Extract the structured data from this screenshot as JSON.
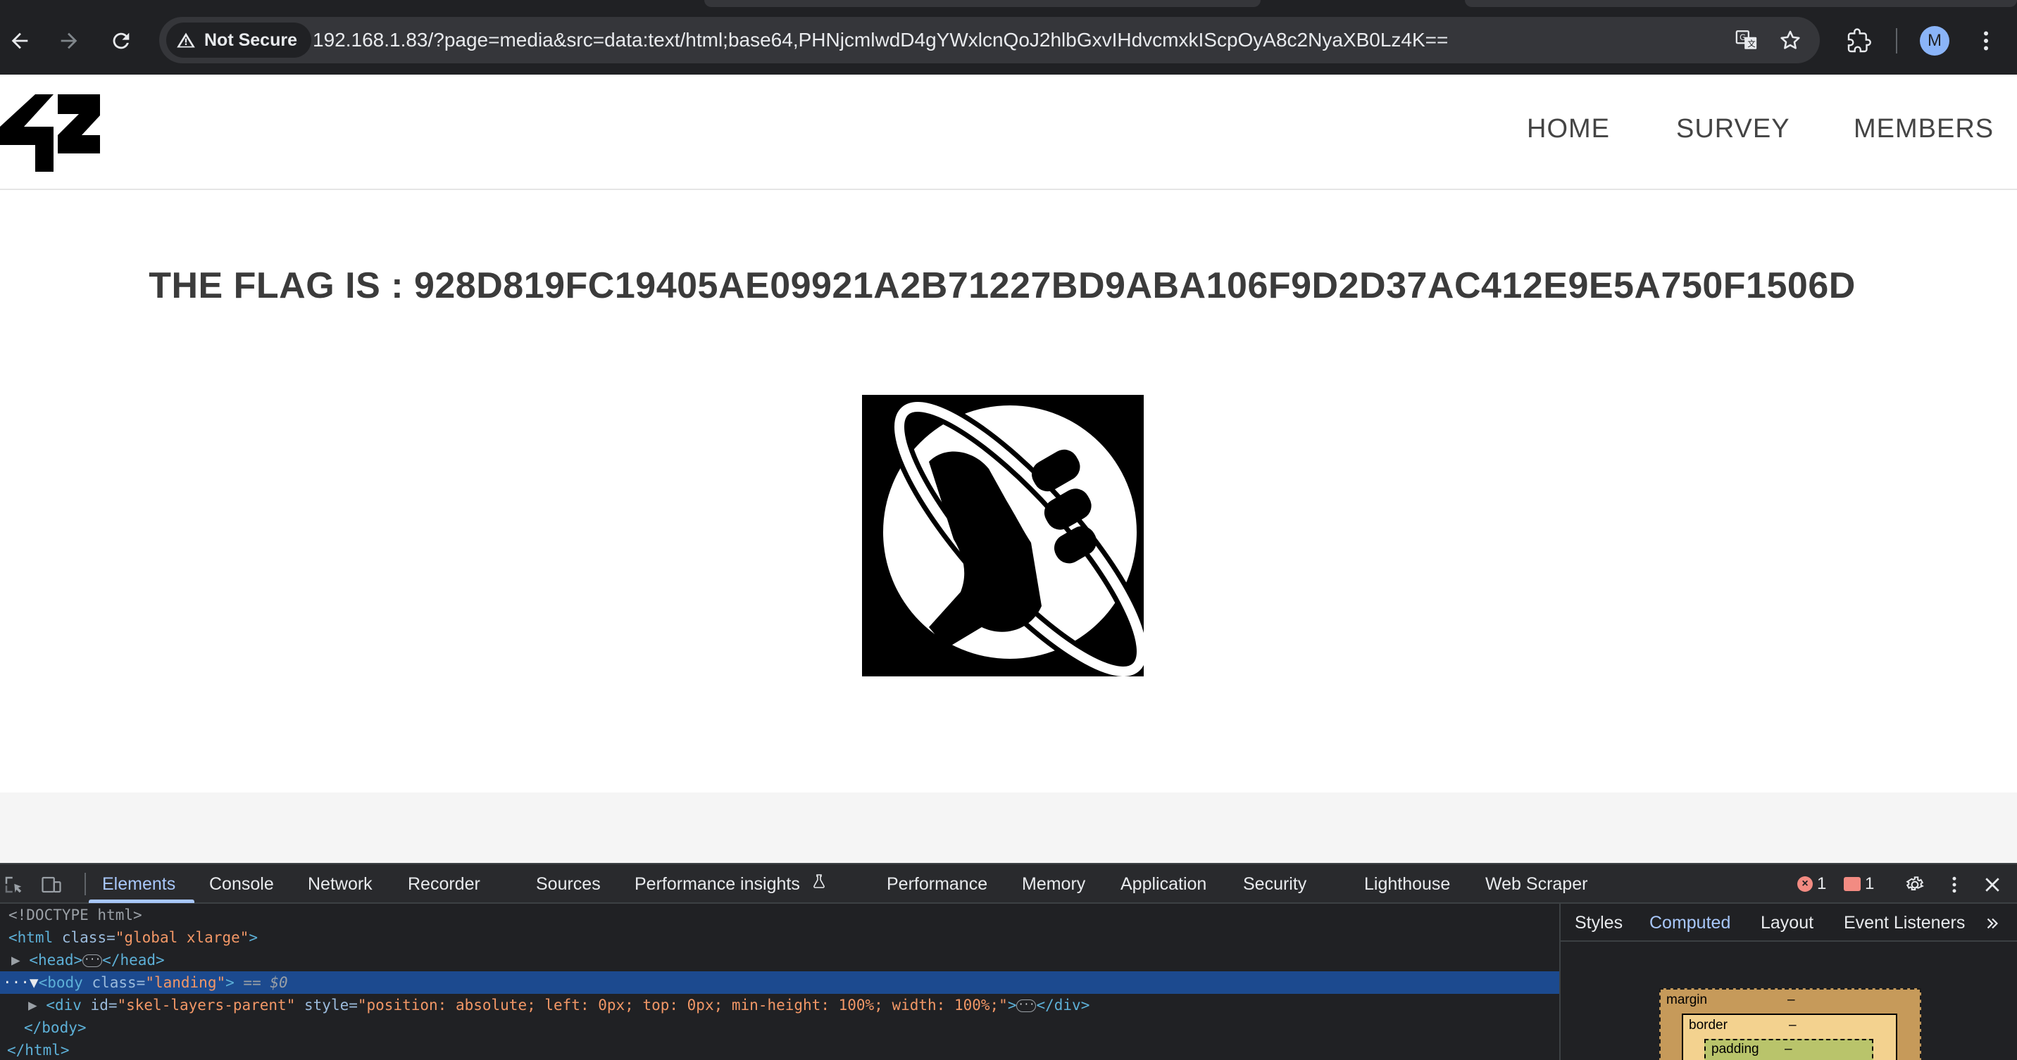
{
  "browser": {
    "security_label": "Not Secure",
    "url": "192.168.1.83/?page=media&src=data:text/html;base64,PHNjcmlwdD4gYWxlcnQoJ2hlbGxvIHdvcmxkIScpOyA8c2NyaXB0Lz4K==",
    "profile_initial": "M"
  },
  "site": {
    "nav": [
      "HOME",
      "SURVEY",
      "MEMBERS"
    ],
    "flag_text": "THE FLAG IS : 928D819FC19405AE09921A2B71227BD9ABA106F9D2D37AC412E9E5A750F1506D"
  },
  "devtools": {
    "tabs": [
      "Elements",
      "Console",
      "Network",
      "Recorder",
      "Sources",
      "Performance insights",
      "Performance",
      "Memory",
      "Application",
      "Security",
      "Lighthouse",
      "Web Scraper"
    ],
    "active_tab": "Elements",
    "error_count": "1",
    "issue_count": "1",
    "dom": {
      "doctype": "<!DOCTYPE html>",
      "html_open_tag": "<html",
      "html_class_attr": "class=",
      "html_class_value": "\"global xlarge\"",
      "html_close_bracket": ">",
      "head": "<head>",
      "head_close": "</head>",
      "body_open": "<body",
      "body_class_attr": "class=",
      "body_class_value": "\"landing\"",
      "body_close_bracket": ">",
      "selected_marker": "== $0",
      "div_open": "<div",
      "div_id_attr": "id=",
      "div_id_value": "\"skel-layers-parent\"",
      "div_style_attr": "style=",
      "div_style_value": "\"position: absolute; left: 0px; top: 0px; min-height: 100%; width: 100%;\"",
      "div_close_bracket": ">",
      "div_close": "</div>",
      "body_close": "</body>",
      "html_close": "</html>"
    },
    "side_tabs": [
      "Styles",
      "Computed",
      "Layout",
      "Event Listeners"
    ],
    "side_active_tab": "Computed",
    "box_model": {
      "margin_label": "margin",
      "margin_value": "–",
      "border_label": "border",
      "border_value": "–",
      "padding_label": "padding",
      "padding_value": "–"
    }
  }
}
